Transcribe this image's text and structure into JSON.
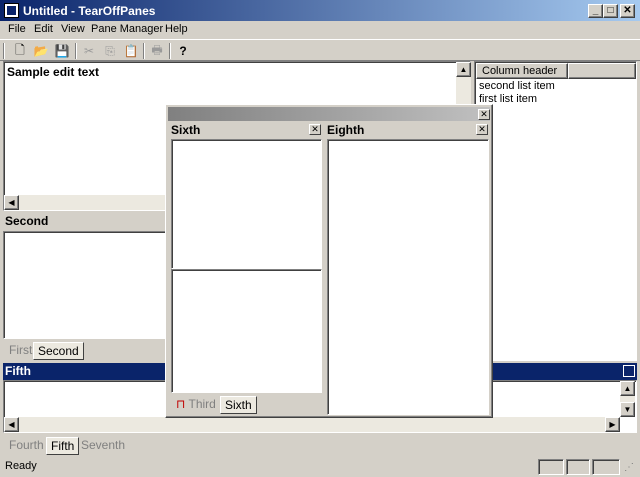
{
  "window": {
    "title": "Untitled - TearOffPanes"
  },
  "menu": [
    "File",
    "Edit",
    "View",
    "Pane Manager",
    "Help"
  ],
  "toolbar": {
    "icons": [
      "new-icon",
      "open-icon",
      "save-icon",
      "cut-icon",
      "copy-icon",
      "paste-icon",
      "print-icon",
      "help-icon"
    ],
    "glyphs": [
      "🗋",
      "📂",
      "💾",
      "✂",
      "⎘",
      "📋",
      "🖶",
      "?"
    ]
  },
  "editor": {
    "text": "Sample edit text"
  },
  "second_pane": {
    "title": "Second"
  },
  "left_tabs": [
    "First",
    "Second"
  ],
  "list_pane": {
    "column_header": "Column header",
    "items": [
      "second list item",
      "first list item"
    ]
  },
  "fifth_pane": {
    "title": "Fifth"
  },
  "bottom_tabs": [
    "Fourth",
    "Fifth",
    "Seventh"
  ],
  "floating": {
    "sixth_title": "Sixth",
    "eighth_title": "Eighth",
    "tabs": [
      "Third",
      "Sixth"
    ]
  },
  "status": {
    "text": "Ready"
  },
  "colors": {
    "title_start": "#0a246a",
    "title_end": "#a6caf0",
    "face": "#d4d0c8",
    "fifth_bar": "#0a246a"
  }
}
